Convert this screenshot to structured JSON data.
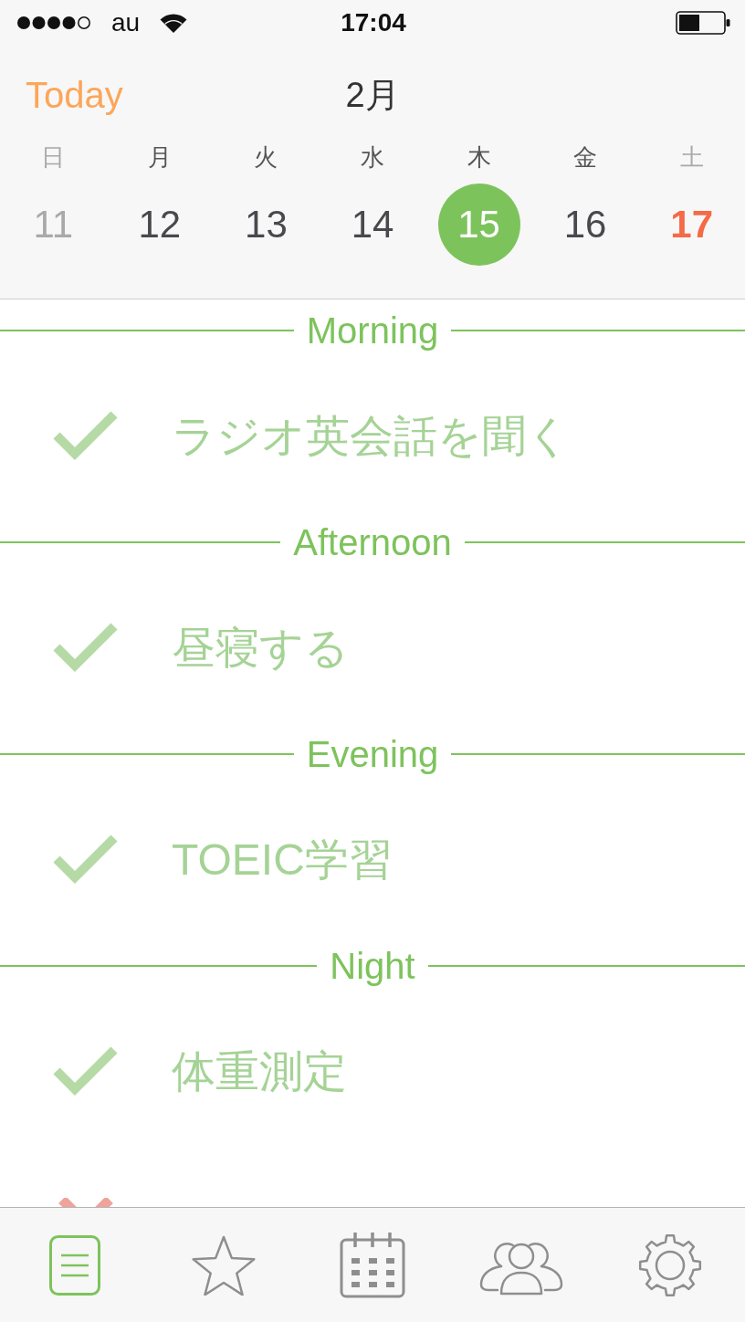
{
  "status_bar": {
    "carrier": "au",
    "time": "17:04"
  },
  "header": {
    "today_button": "Today",
    "month": "2月"
  },
  "week": {
    "days": [
      {
        "label": "日",
        "muted": true
      },
      {
        "label": "月",
        "muted": false
      },
      {
        "label": "火",
        "muted": false
      },
      {
        "label": "水",
        "muted": false
      },
      {
        "label": "木",
        "muted": false
      },
      {
        "label": "金",
        "muted": false
      },
      {
        "label": "土",
        "muted": true
      }
    ],
    "dates": [
      {
        "label": "11",
        "color": "#a9a9a9",
        "selected": false,
        "today": false
      },
      {
        "label": "12",
        "color": "#48484d",
        "selected": false,
        "today": false
      },
      {
        "label": "13",
        "color": "#48484d",
        "selected": false,
        "today": false
      },
      {
        "label": "14",
        "color": "#48484d",
        "selected": false,
        "today": false
      },
      {
        "label": "15",
        "selected": true,
        "today": false
      },
      {
        "label": "16",
        "color": "#48484d",
        "selected": false,
        "today": false
      },
      {
        "label": "17",
        "color": "#f56a47",
        "selected": false,
        "today": true
      }
    ]
  },
  "sections": [
    {
      "title": "Morning",
      "tasks": [
        {
          "title": "ラジオ英会話を聞く",
          "done": true
        }
      ]
    },
    {
      "title": "Afternoon",
      "tasks": [
        {
          "title": "昼寝する",
          "done": true
        }
      ]
    },
    {
      "title": "Evening",
      "tasks": [
        {
          "title": "TOEIC学習",
          "done": true
        }
      ]
    },
    {
      "title": "Night",
      "tasks": [
        {
          "title": "体重測定",
          "done": true
        },
        {
          "done": false
        }
      ]
    }
  ],
  "tab_bar": [
    {
      "kind": "list",
      "selected": true
    },
    {
      "kind": "star",
      "selected": false
    },
    {
      "kind": "calendar",
      "selected": false
    },
    {
      "kind": "people",
      "selected": false
    },
    {
      "kind": "gear",
      "selected": false
    }
  ]
}
